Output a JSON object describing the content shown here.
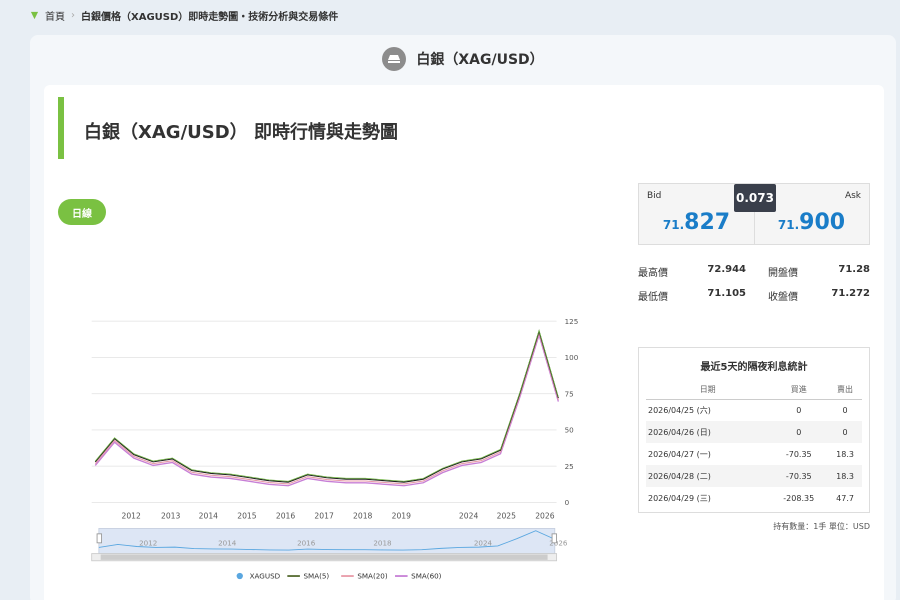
{
  "breadcrumb": {
    "home": "首頁",
    "current": "白銀價格（XAGUSD）即時走勢圖・技術分析與交易條件"
  },
  "header": {
    "title": "白銀（XAG/USD）",
    "icon": "silver-bar-icon"
  },
  "main": {
    "title": "白銀（XAG/USD） 即時行情與走勢圖",
    "period_button": "日線"
  },
  "quote": {
    "bid_label": "Bid",
    "bid_small": "71.",
    "bid_big": "827",
    "ask_label": "Ask",
    "ask_small": "71.",
    "ask_big": "900",
    "spread": "0.073"
  },
  "stats": {
    "high_label": "最高價",
    "high": "72.944",
    "open_label": "開盤價",
    "open": "71.28",
    "low_label": "最低價",
    "low": "71.105",
    "close_label": "收盤價",
    "close": "71.272"
  },
  "swap": {
    "title": "最近5天的隔夜利息統計",
    "headers": [
      "日期",
      "買進",
      "賣出"
    ],
    "rows": [
      [
        "2026/04/25 (六)",
        "0",
        "0"
      ],
      [
        "2026/04/26 (日)",
        "0",
        "0"
      ],
      [
        "2026/04/27 (一)",
        "-70.35",
        "18.3"
      ],
      [
        "2026/04/28 (二)",
        "-70.35",
        "18.3"
      ],
      [
        "2026/04/29 (三)",
        "-208.35",
        "47.7"
      ]
    ],
    "footnote": "持有數量：1手 單位：USD"
  },
  "colors": {
    "accent": "#7ac142",
    "price_blue": "#1a7dc8",
    "sma5": "#556b2f",
    "sma20": "#e89aa8",
    "sma60": "#c77fd6",
    "xagusd": "#5aa7e0"
  },
  "chart_data": {
    "type": "line",
    "title": "",
    "ylim": [
      0,
      125
    ],
    "y_ticks": [
      0,
      25,
      50,
      75,
      100,
      125
    ],
    "x_ticks": [
      "2012",
      "2013",
      "2014",
      "2015",
      "2016",
      "2017",
      "2018",
      "2019",
      "2024",
      "2025",
      "2026"
    ],
    "navigator_ticks": [
      "2012",
      "2014",
      "2016",
      "2018",
      "2024",
      "2026"
    ],
    "legend_position": "bottom",
    "series": [
      {
        "name": "XAGUSD",
        "x": [
          "2011",
          "2011.5",
          "2012",
          "2012.5",
          "2013",
          "2013.5",
          "2014",
          "2014.5",
          "2015",
          "2015.5",
          "2016",
          "2016.5",
          "2017",
          "2017.5",
          "2018",
          "2018.5",
          "2019",
          "2019.5",
          "2024",
          "2024.5",
          "2025",
          "2025.5",
          "2026",
          "2026.2",
          "2026.3"
        ],
        "values": [
          28,
          44,
          33,
          28,
          30,
          22,
          20,
          19,
          17,
          15,
          14,
          19,
          17,
          16,
          16,
          15,
          14,
          16,
          23,
          28,
          30,
          36,
          75,
          118,
          72
        ]
      },
      {
        "name": "SMA(5)",
        "values": []
      },
      {
        "name": "SMA(20)",
        "values": []
      },
      {
        "name": "SMA(60)",
        "values": []
      }
    ]
  }
}
